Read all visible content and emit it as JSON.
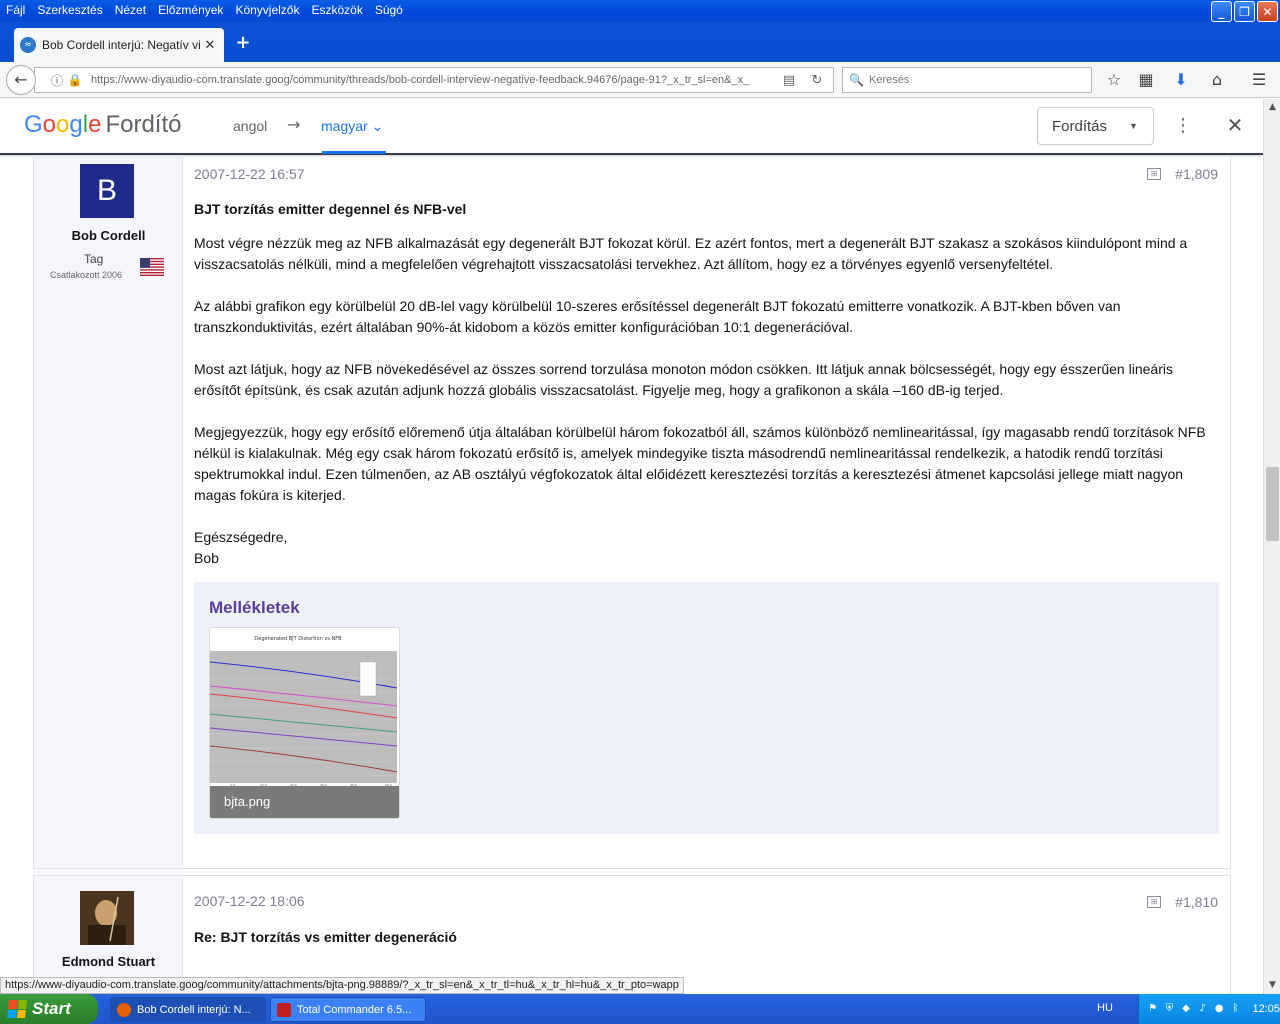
{
  "menu": [
    "Fájl",
    "Szerkesztés",
    "Nézet",
    "Előzmények",
    "Könyvjelzők",
    "Eszközök",
    "Súgó"
  ],
  "tab": {
    "title": "Bob Cordell interjú: Negatív vi..."
  },
  "nav": {
    "url": "https://www-diyaudio-com.translate.goog/community/threads/bob-cordell-interview-negative-feedback.94676/page-91?_x_tr_sl=en&_x_",
    "search_placeholder": "Keresés"
  },
  "translate_bar": {
    "logo_google": "Google",
    "logo_product": "Fordító",
    "source_lang": "angol",
    "target_lang": "magyar",
    "button_label": "Fordítás"
  },
  "post1": {
    "date": "2007-12-22 16:57",
    "number": "#1,809",
    "author": "Bob Cordell",
    "avatar_letter": "B",
    "avatar_color": "#1f2a8a",
    "role": "Tag",
    "joined": "Csatlakozott 2006",
    "title": "BJT torzítás emitter degennel és NFB-vel",
    "paragraphs": [
      "Most végre nézzük meg az NFB alkalmazását egy degenerált BJT fokozat körül. Ez azért fontos, mert a degenerált BJT szakasz a szokásos kiindulópont mind a visszacsatolás nélküli, mind a megfelelően végrehajtott visszacsatolási tervekhez. Azt állítom, hogy ez a törvényes egyenlő versenyfeltétel.",
      "Az alábbi grafikon egy körülbelül 20 dB-lel vagy körülbelül 10-szeres erősítéssel degenerált BJT fokozatú emitterre vonatkozik. A BJT-kben bőven van transzkonduktivitás, ezért általában 90%-át kidobom a közös emitter konfigurációban 10:1 degenerációval.",
      "Most azt látjuk, hogy az NFB növekedésével az összes sorrend torzulása monoton módon csökken. Itt látjuk annak bölcsességét, hogy egy ésszerűen lineáris erősítőt építsünk, és csak azután adjunk hozzá globális visszacsatolást. Figyelje meg, hogy a grafikonon a skála –160 dB-ig terjed.",
      "Megjegyezzük, hogy egy erősítő előremenő útja általában körülbelül három fokozatból áll, számos különböző nemlinearitással, így magasabb rendű torzítások NFB nélkül is kialakulnak. Még egy csak három fokozatú erősítő is, amelyek mindegyike tiszta másodrendű nemlinearitással rendelkezik, a hatodik rendű torzítási spektrumokkal indul. Ezen túlmenően, az AB osztályú végfokozatok által előidézett keresztezési torzítás a keresztezési átmenet kapcsolási jellege miatt nagyon magas fokúra is kiterjed."
    ],
    "signoff": "Egészségedre,",
    "signature": "Bob",
    "attachments_title": "Mellékletek",
    "attachment_name": "bjta.png",
    "thumb_chart_title": "Degenerated BJT Distortion vs NFB"
  },
  "post2": {
    "date": "2007-12-22 18:06",
    "number": "#1,810",
    "author": "Edmond Stuart",
    "title": "Re: BJT torzítás vs emitter degeneráció"
  },
  "status_url": "https://www-diyaudio-com.translate.goog/community/attachments/bjta-png.98889/?_x_tr_sl=en&_x_tr_tl=hu&_x_tr_hl=hu&_x_tr_pto=wapp",
  "taskbar": {
    "start": "Start",
    "items": [
      "Bob Cordell interjú: N...",
      "Total Commander 6.5..."
    ],
    "lang": "HU",
    "clock": "12:05"
  },
  "icons": [
    "back-icon",
    "info-icon",
    "lock-warning-icon",
    "reader-icon",
    "reload-icon",
    "search-icon",
    "star-icon",
    "library-icon",
    "download-icon",
    "home-icon",
    "menu-icon"
  ]
}
